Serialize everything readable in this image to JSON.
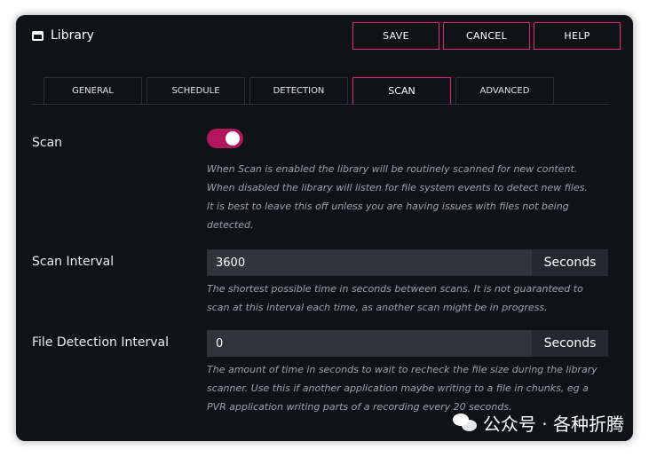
{
  "window": {
    "title": "Library",
    "icon": "window-icon"
  },
  "toolbar": {
    "save_label": "SAVE",
    "cancel_label": "CANCEL",
    "help_label": "HELP",
    "accent_color": "#e3267b"
  },
  "tabs": [
    {
      "label": "GENERAL",
      "active": false
    },
    {
      "label": "SCHEDULE",
      "active": false
    },
    {
      "label": "DETECTION",
      "active": false
    },
    {
      "label": "SCAN",
      "active": true
    },
    {
      "label": "ADVANCED",
      "active": false
    }
  ],
  "scan": {
    "label": "Scan",
    "enabled": true,
    "help_lines": [
      "When Scan is enabled the library will be routinely scanned for new content.",
      "When disabled the library will listen for file system events to detect new files.",
      "It is best to leave this off unless you are having issues with files not being",
      "detected."
    ]
  },
  "scan_interval": {
    "label": "Scan Interval",
    "value": "3600",
    "unit": "Seconds",
    "help_lines": [
      "The shortest possible time in seconds between scans.  It is not guaranteed to",
      "scan at this interval each time, as another scan might be in progress."
    ]
  },
  "file_detection_interval": {
    "label": "File Detection Interval",
    "value": "0",
    "unit": "Seconds",
    "help_lines": [
      "The amount of time in seconds to wait to recheck the file size during the library",
      "scanner.  Use this if another application maybe writing to a file in chunks, eg a",
      "PVR application writing parts of a recording every 20 seconds."
    ]
  },
  "watermark": {
    "icon": "wechat-icon",
    "text": "公众号 · 各种折腾"
  }
}
